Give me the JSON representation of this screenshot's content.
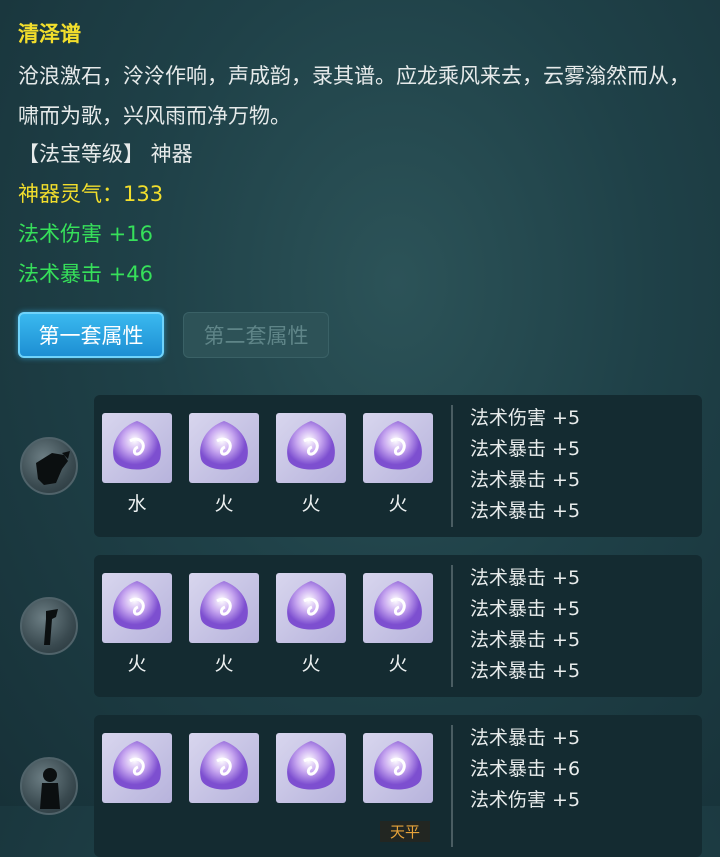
{
  "item": {
    "name": "清泽谱",
    "description": "沧浪激石，泠泠作响，声成韵，录其谱。应龙乘风来去，云雾滃然而从，啸而为歌，兴风雨而净万物。",
    "grade_line": "【法宝等级】 神器",
    "aura_line": "神器灵气：133",
    "bonus_1": "法术伤害 +16",
    "bonus_2": "法术暴击 +46"
  },
  "tabs": [
    {
      "label": "第一套属性",
      "active": true
    },
    {
      "label": "第二套属性",
      "active": false
    }
  ],
  "sets": [
    {
      "avatar_icon": "shield-pouch-icon",
      "gems": [
        {
          "icon": "crystal-orb-icon",
          "element": "水"
        },
        {
          "icon": "crystal-orb-icon",
          "element": "火"
        },
        {
          "icon": "crystal-orb-icon",
          "element": "火"
        },
        {
          "icon": "crystal-orb-icon",
          "element": "火"
        }
      ],
      "stats": [
        "法术伤害 +5",
        "法术暴击 +5",
        "法术暴击 +5",
        "法术暴击 +5"
      ]
    },
    {
      "avatar_icon": "rod-icon",
      "gems": [
        {
          "icon": "crystal-orb-icon",
          "element": "火"
        },
        {
          "icon": "crystal-orb-icon",
          "element": "火"
        },
        {
          "icon": "crystal-orb-icon",
          "element": "火"
        },
        {
          "icon": "crystal-orb-icon",
          "element": "火"
        }
      ],
      "stats": [
        "法术暴击 +5",
        "法术暴击 +5",
        "法术暴击 +5",
        "法术暴击 +5"
      ]
    },
    {
      "avatar_icon": "figure-icon",
      "gems": [
        {
          "icon": "crystal-orb-icon",
          "element": ""
        },
        {
          "icon": "crystal-orb-icon",
          "element": ""
        },
        {
          "icon": "crystal-orb-icon",
          "element": ""
        },
        {
          "icon": "crystal-orb-icon",
          "element": "",
          "overlay": "天平"
        }
      ],
      "stats": [
        "法术暴击 +5",
        "法术暴击 +6",
        "法术伤害 +5"
      ]
    }
  ],
  "colors": {
    "title": "#f2de2c",
    "aura": "#f2de2c",
    "bonus": "#36e05a",
    "tab_active": "#2aa6e3",
    "panel": "#142b31"
  }
}
